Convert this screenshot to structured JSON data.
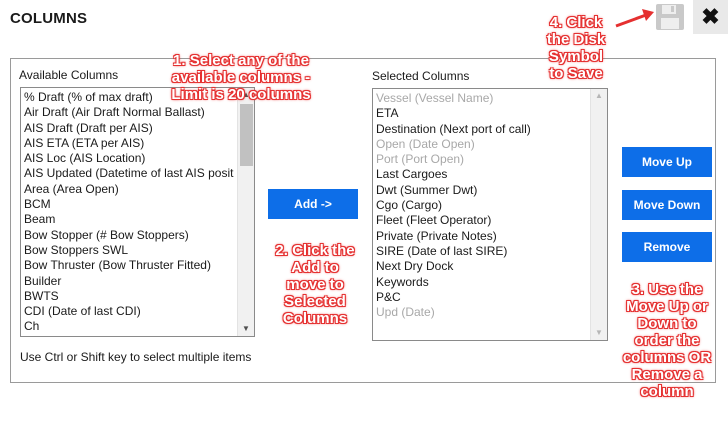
{
  "dialog": {
    "title": "COLUMNS"
  },
  "toolbar": {
    "save_icon": "floppy-disk-icon",
    "close_icon": "close-icon",
    "close_glyph": "✖"
  },
  "available": {
    "label": "Available Columns",
    "items": [
      "% Draft (% of max draft)",
      "Air Draft (Air Draft Normal Ballast)",
      "AIS Draft (Draft per AIS)",
      "AIS ETA (ETA per AIS)",
      "AIS Loc (AIS Location)",
      "AIS Updated (Datetime of last AIS position)",
      "Area (Area Open)",
      "BCM",
      "Beam",
      "Bow Stopper (# Bow Stoppers)",
      "Bow Stoppers SWL",
      "Bow Thruster (Bow Thruster Fitted)",
      "Builder",
      "BWTS",
      "CDI (Date of last CDI)",
      "Ch"
    ]
  },
  "selected": {
    "label": "Selected Columns",
    "items": [
      {
        "text": "Vessel (Vessel Name)",
        "disabled": true
      },
      {
        "text": "ETA",
        "disabled": false
      },
      {
        "text": "Destination (Next port of call)",
        "disabled": false
      },
      {
        "text": "Open (Date Open)",
        "disabled": true
      },
      {
        "text": "Port (Port Open)",
        "disabled": true
      },
      {
        "text": "Last Cargoes",
        "disabled": false
      },
      {
        "text": "Dwt (Summer Dwt)",
        "disabled": false
      },
      {
        "text": "Cgo (Cargo)",
        "disabled": false
      },
      {
        "text": "Fleet (Fleet Operator)",
        "disabled": false
      },
      {
        "text": "Private (Private Notes)",
        "disabled": false
      },
      {
        "text": "SIRE (Date of last SIRE)",
        "disabled": false
      },
      {
        "text": "Next Dry Dock",
        "disabled": false
      },
      {
        "text": "Keywords",
        "disabled": false
      },
      {
        "text": "P&C",
        "disabled": false
      },
      {
        "text": "Upd (Date)",
        "disabled": true
      }
    ]
  },
  "buttons": {
    "add": "Add ->",
    "move_up": "Move Up",
    "move_down": "Move Down",
    "remove": "Remove"
  },
  "hint": "Use Ctrl or Shift key to select multiple items",
  "annotations": {
    "note1": [
      "1. Select any of the",
      "available columns -",
      "Limit is 20 columns"
    ],
    "note2": [
      "2. Click the",
      "Add to",
      "move to",
      "Selected",
      "Columns"
    ],
    "note3": [
      "3. Use the",
      "Move Up or",
      "Down to",
      "order the",
      "columns OR",
      "Remove a",
      "column"
    ],
    "note4": [
      "4. Click",
      "the Disk",
      "Symbol",
      "to Save"
    ]
  },
  "colors": {
    "button": "#0d6ee8",
    "annotation_outline": "#e53030",
    "disabled_text": "#a8a8a8"
  }
}
